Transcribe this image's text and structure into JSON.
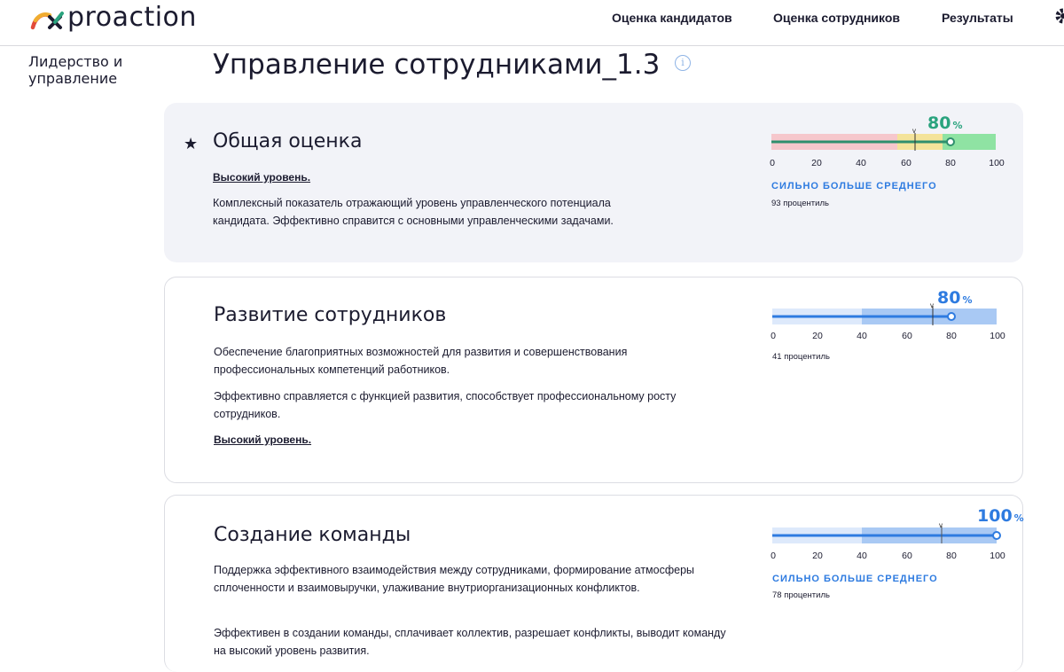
{
  "header": {
    "logo_text": "proaction",
    "nav": [
      "Оценка кандидатов",
      "Оценка сотрудников",
      "Результаты"
    ]
  },
  "sidebar": {
    "category": "Лидерство и управление"
  },
  "page": {
    "title": "Управление сотрудниками_1.3"
  },
  "scale_ticks": [
    "0",
    "20",
    "40",
    "60",
    "80",
    "100"
  ],
  "cards": [
    {
      "title": "Общая оценка",
      "level": "Высокий уровень.",
      "description": "Комплексный показатель отражающий уровень управленческого потенциала кандидата. Эффективно справится с основными управленческими задачами.",
      "score": "80",
      "score_value": 80,
      "marker_value": 64,
      "score_unit": "%",
      "caption": "СИЛЬНО БОЛЬШЕ СРЕДНЕГО",
      "percentile": "93 процентиль",
      "score_color": "#2aa37e"
    },
    {
      "title": "Развитие сотрудников",
      "description1": "Обеспечение благоприятных возможностей для развития и совершенствования профессиональных компетенций работников.",
      "description2": " Эффективно справляется с функцией развития, способствует профессиональному росту сотрудников.",
      "level": "Высокий уровень.",
      "score": "80",
      "score_value": 80,
      "marker_value": 72,
      "score_unit": "%",
      "percentile": "41 процентиль",
      "score_color": "#2e7be0"
    },
    {
      "title": "Создание команды",
      "description1": "Поддержка эффективного взаимодействия между сотрудниками, формирование атмосферы сплоченности и взаимовыручки, улаживание внутриорганизационных конфликтов.",
      "description2": " Эффективен в создании команды, сплачивает коллектив, разрешает конфликты, выводит команду на высокий уровень развития.",
      "score": "100",
      "score_value": 100,
      "marker_value": 76,
      "score_unit": "%",
      "caption": "СИЛЬНО БОЛЬШЕ СРЕДНЕГО",
      "percentile": "78 процентиль",
      "score_color": "#2e7be0"
    }
  ]
}
